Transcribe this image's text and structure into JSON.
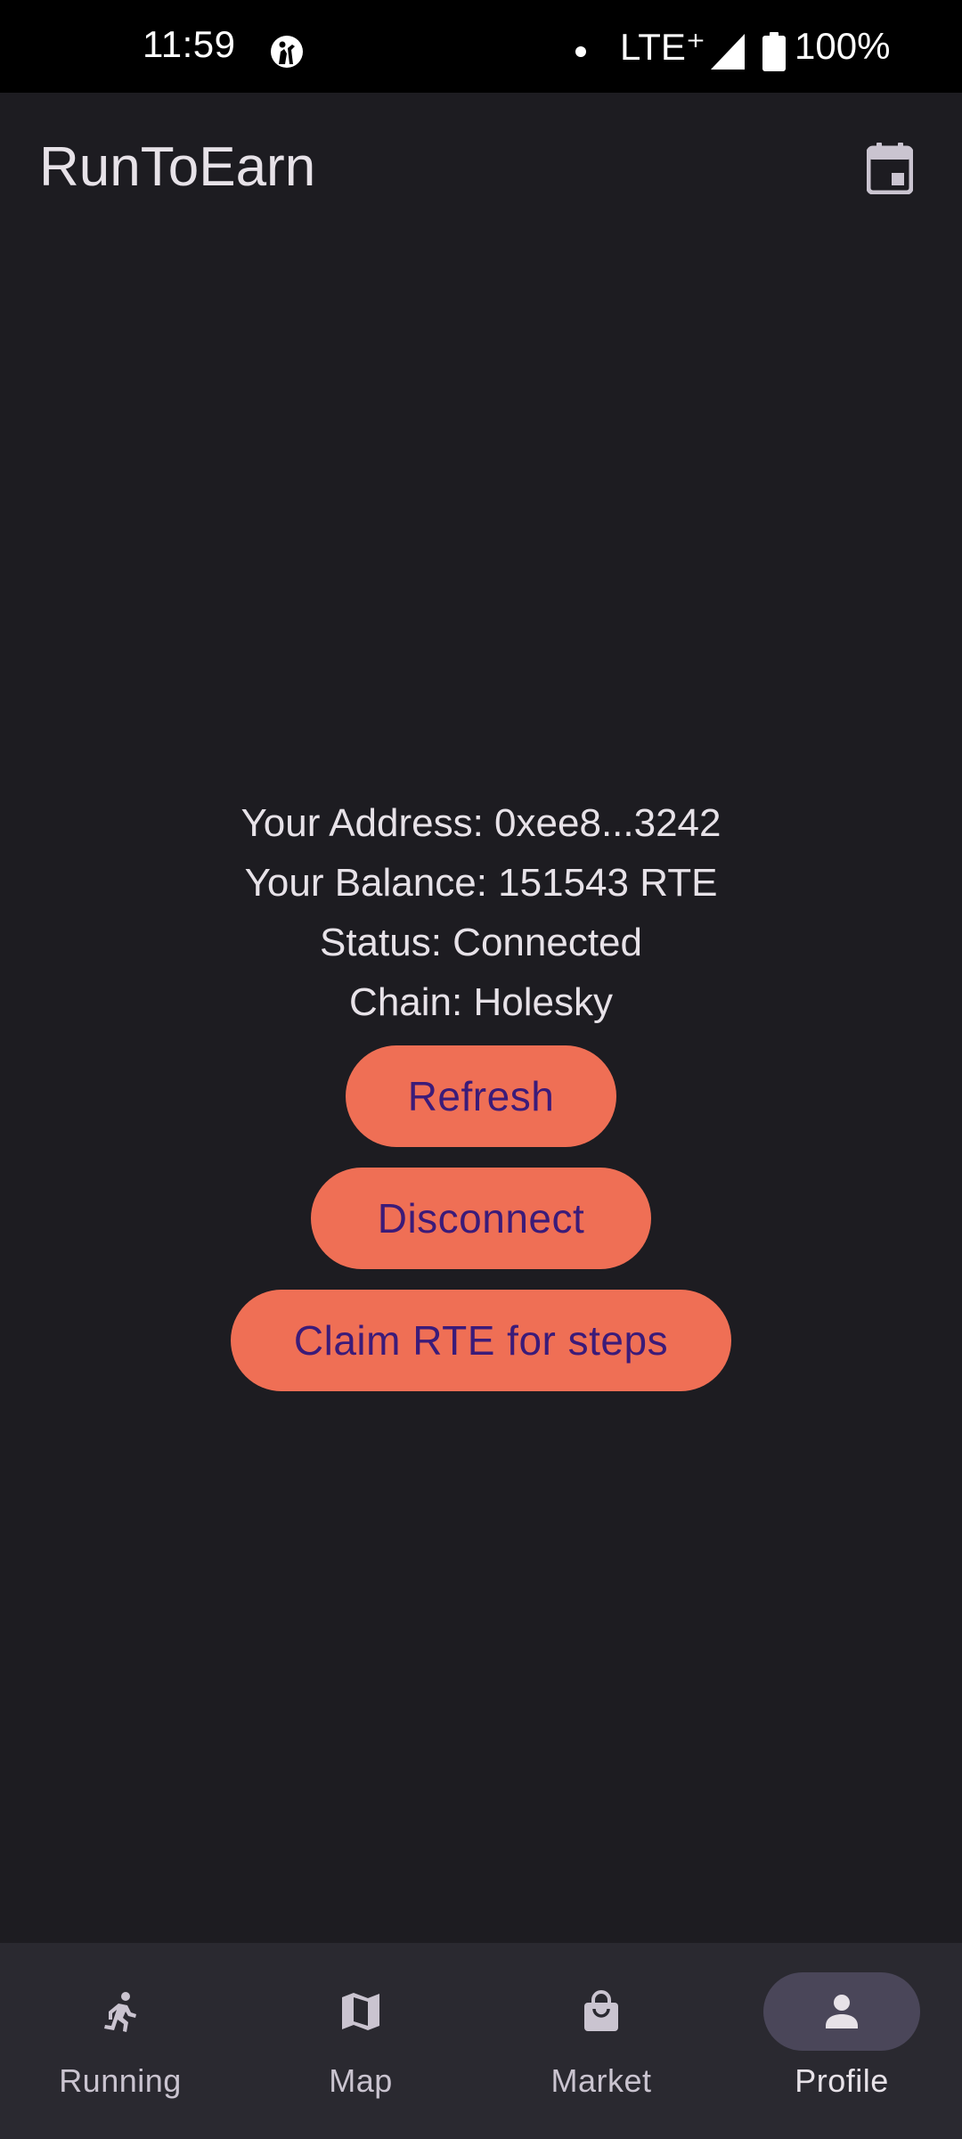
{
  "status_bar": {
    "time": "11:59",
    "app_icon": "app-notification-icon",
    "network": "LTE⁺",
    "battery": "100%"
  },
  "app_bar": {
    "title": "RunToEarn",
    "action_icon": "calendar-icon"
  },
  "profile": {
    "address_line": "Your Address: 0xee8...3242",
    "balance_line": "Your Balance: 151543 RTE",
    "status_line": "Status: Connected",
    "chain_line": "Chain: Holesky"
  },
  "buttons": {
    "refresh": "Refresh",
    "disconnect": "Disconnect",
    "claim": "Claim RTE for steps"
  },
  "bottom_nav": {
    "items": [
      {
        "label": "Running",
        "icon": "running-icon",
        "active": false
      },
      {
        "label": "Map",
        "icon": "map-icon",
        "active": false
      },
      {
        "label": "Market",
        "icon": "shopping-bag-icon",
        "active": false
      },
      {
        "label": "Profile",
        "icon": "person-icon",
        "active": true
      }
    ]
  },
  "colors": {
    "background": "#1d1c21",
    "status_bar": "#000000",
    "button_fill": "#ef6f55",
    "button_text": "#3b1b79",
    "nav_background": "#2a2930",
    "nav_active_indicator": "#4a4659"
  }
}
